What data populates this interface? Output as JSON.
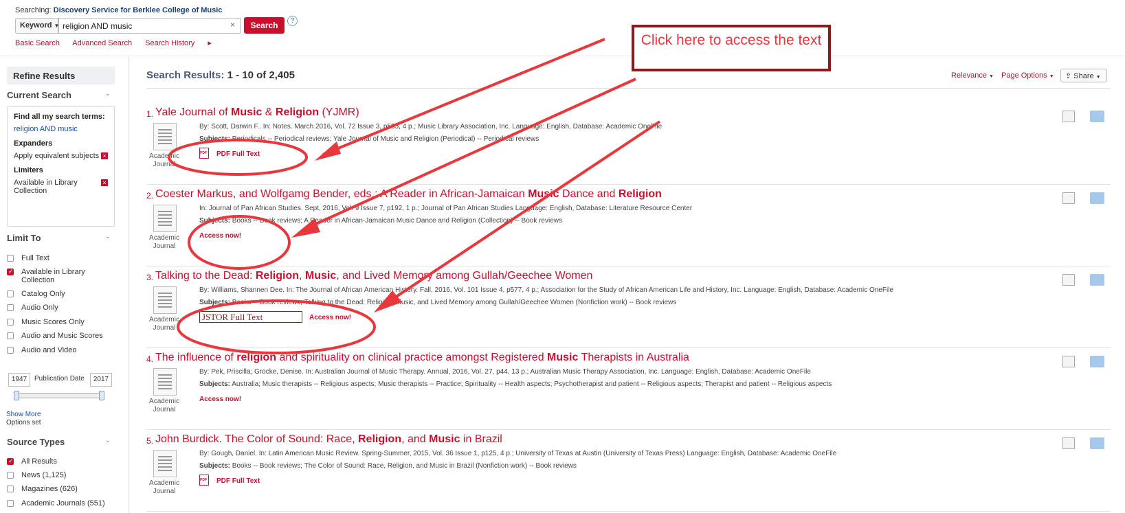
{
  "top": {
    "searching_label": "Searching:",
    "searching_target": "Discovery Service for Berklee College of Music",
    "field_select": "Keyword",
    "query": "religion AND music",
    "search_button": "Search",
    "help": "?",
    "links": [
      "Basic Search",
      "Advanced Search",
      "Search History"
    ]
  },
  "sidebar": {
    "refine_title": "Refine Results",
    "current_search_head": "Current Search",
    "find_all_label": "Find all my search terms:",
    "find_all_value": "religion AND music",
    "expanders_label": "Expanders",
    "expander_item": "Apply equivalent subjects",
    "limiters_label": "Limiters",
    "limiter_item": "Available in Library Collection",
    "limit_to_head": "Limit To",
    "limit_items": [
      {
        "label": "Full Text",
        "checked": false
      },
      {
        "label": "Available in Library Collection",
        "checked": true
      },
      {
        "label": "Catalog Only",
        "checked": false
      },
      {
        "label": "Audio Only",
        "checked": false
      },
      {
        "label": "Music Scores Only",
        "checked": false
      },
      {
        "label": "Audio and Music Scores",
        "checked": false
      },
      {
        "label": "Audio and Video",
        "checked": false
      }
    ],
    "date_from": "1947",
    "date_label": "Publication Date",
    "date_to": "2017",
    "show_more": "Show More",
    "options_set": "Options set",
    "source_types_head": "Source Types",
    "source_items": [
      {
        "label": "All Results",
        "checked": true
      },
      {
        "label": "News (1,125)",
        "checked": false
      },
      {
        "label": "Magazines (626)",
        "checked": false
      },
      {
        "label": "Academic Journals (551)",
        "checked": false
      }
    ]
  },
  "main": {
    "results_label": "Search Results:",
    "results_range": "1 - 10 of 2,405",
    "relevance": "Relevance",
    "page_options": "Page Options",
    "share": "Share",
    "results": [
      {
        "num": "1.",
        "title_parts": [
          "Yale Journal of ",
          "Music",
          " & ",
          "Religion",
          " (YJMR)"
        ],
        "meta": "By: Scott, Darwin F.. In: Notes. March 2016, Vol. 72 Issue 3, p585, 4 p.; Music Library Association, Inc. Language: English, Database: Academic OneFile",
        "subjects_label": "Subjects:",
        "subjects": "Periodicals -- Periodical reviews; Yale Journal of Music and Religion (Periodical) -- Periodical reviews",
        "type": "Academic Journal",
        "link_text": "PDF Full Text"
      },
      {
        "num": "2.",
        "title_parts": [
          "Coester Markus, and Wolfgamg Bender, eds.: A Reader in African-Jamaican ",
          "Music",
          " Dance and ",
          "Religion",
          ""
        ],
        "meta": "In: Journal of Pan African Studies. Sept, 2016, Vol. 9 Issue 7, p192, 1 p.; Journal of Pan African Studies Language: English, Database: Literature Resource Center",
        "subjects_label": "Subjects:",
        "subjects": "Books -- Book reviews; A Reader in African-Jamaican Music Dance and Religion (Collection) -- Book reviews",
        "type": "Academic Journal",
        "link_text": "Access now!"
      },
      {
        "num": "3.",
        "title_parts": [
          "Talking to the Dead: ",
          "Religion",
          ", ",
          "Music",
          ", and Lived Memory among Gullah/Geechee Women"
        ],
        "meta": "By: Williams, Shannen Dee. In: The Journal of African American History. Fall, 2016, Vol. 101 Issue 4, p577, 4 p.; Association for the Study of African American Life and History, Inc. Language: English, Database: Academic OneFile",
        "subjects_label": "Subjects:",
        "subjects": "Books -- Book reviews; Talking to the Dead: Religion, Music, and Lived Memory among Gullah/Geechee Women (Nonfiction work) -- Book reviews",
        "type": "Academic Journal",
        "jstor_text": "JSTOR Full Text",
        "link_text": "Access now!"
      },
      {
        "num": "4.",
        "title_parts": [
          "The influence of ",
          "religion",
          " and spirituality on clinical practice amongst Registered ",
          "Music",
          " Therapists in Australia"
        ],
        "meta": "By: Pek, Priscilla; Grocke, Denise. In: Australian Journal of Music Therapy. Annual, 2016, Vol. 27, p44, 13 p.; Australian Music Therapy Association, Inc. Language: English, Database: Academic OneFile",
        "subjects_label": "Subjects:",
        "subjects": "Australia; Music therapists -- Religious aspects; Music therapists -- Practice; Spirituality -- Health aspects; Psychotherapist and patient -- Religious aspects; Therapist and patient -- Religious aspects",
        "type": "Academic Journal",
        "link_text": "Access now!"
      },
      {
        "num": "5.",
        "title_parts": [
          "John Burdick. The Color of Sound: Race, ",
          "Religion",
          ", and ",
          "Music",
          " in Brazil"
        ],
        "meta": "By: Gough, Daniel. In: Latin American Music Review. Spring-Summer, 2015, Vol. 36 Issue 1, p125, 4 p.; University of Texas at Austin (University of Texas Press) Language: English, Database: Academic OneFile",
        "subjects_label": "Subjects:",
        "subjects": "Books -- Book reviews; The Color of Sound: Race, Religion, and Music in Brazil (Nonfiction work) -- Book reviews",
        "type": "Academic Journal",
        "link_text": "PDF Full Text"
      }
    ]
  },
  "annotation": {
    "callout_text": "Click here to access the text",
    "color": "#e8383d"
  }
}
